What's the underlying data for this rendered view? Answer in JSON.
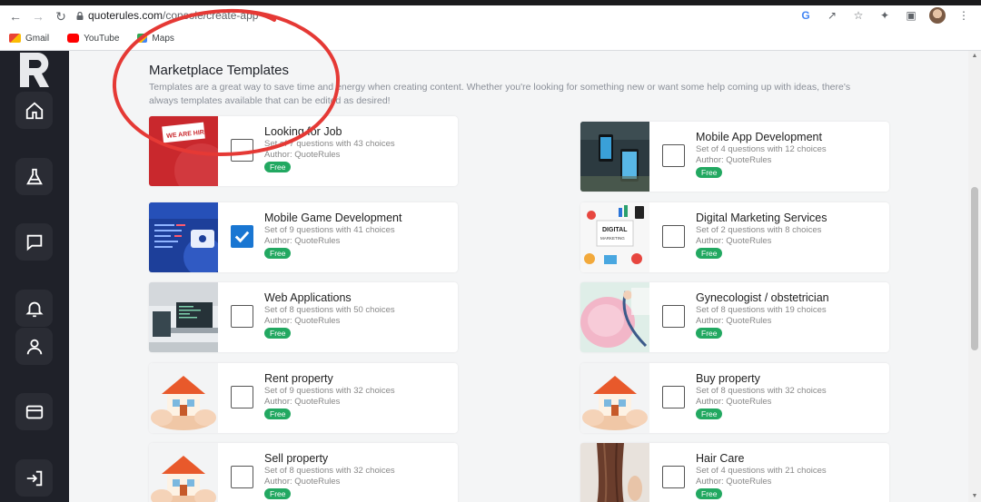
{
  "browser": {
    "url_domain": "quoterules.com",
    "url_path": "/console/create-app",
    "bookmarks": [
      {
        "label": "Gmail",
        "color": "#d93025"
      },
      {
        "label": "YouTube",
        "color": "#ff0000"
      },
      {
        "label": "Maps",
        "color": "#34a853"
      }
    ]
  },
  "sidebar": {
    "items": [
      {
        "icon": "home-icon"
      },
      {
        "icon": "flask-icon"
      },
      {
        "icon": "chat-icon"
      },
      {
        "icon": "bell-icon"
      },
      {
        "icon": "user-icon"
      },
      {
        "icon": "card-icon"
      },
      {
        "icon": "logout-icon"
      }
    ]
  },
  "page": {
    "heading": "Marketplace Templates",
    "description": "Templates are a great way to save time and energy when creating content. Whether you're looking for something new or want some help coming up with ideas, there's always templates available that can be edited as desired!"
  },
  "templates": [
    {
      "title": "Looking for Job",
      "questions": "Set of 7 questions with 43 choices",
      "author": "Author: QuoteRules",
      "badge": "Free",
      "checked": false,
      "thumb": "hiring"
    },
    {
      "title": "Mobile App Development",
      "questions": "Set of 4 questions with 12 choices",
      "author": "Author: QuoteRules",
      "badge": "Free",
      "checked": false,
      "thumb": "phone"
    },
    {
      "title": "Mobile Game Development",
      "questions": "Set of 9 questions with 41 choices",
      "author": "Author: QuoteRules",
      "badge": "Free",
      "checked": true,
      "thumb": "game"
    },
    {
      "title": "Digital Marketing Services",
      "questions": "Set of 2 questions with 8 choices",
      "author": "Author: QuoteRules",
      "badge": "Free",
      "checked": false,
      "thumb": "marketing"
    },
    {
      "title": "Web Applications",
      "questions": "Set of 8 questions with 50 choices",
      "author": "Author: QuoteRules",
      "badge": "Free",
      "checked": false,
      "thumb": "laptop"
    },
    {
      "title": "Gynecologist / obstetrician",
      "questions": "Set of 8 questions with 19 choices",
      "author": "Author: QuoteRules",
      "badge": "Free",
      "checked": false,
      "thumb": "pregnant"
    },
    {
      "title": "Rent property",
      "questions": "Set of 9 questions with 32 choices",
      "author": "Author: QuoteRules",
      "badge": "Free",
      "checked": false,
      "thumb": "house"
    },
    {
      "title": "Buy property",
      "questions": "Set of 8 questions with 32 choices",
      "author": "Author: QuoteRules",
      "badge": "Free",
      "checked": false,
      "thumb": "house"
    },
    {
      "title": "Sell property",
      "questions": "Set of 8 questions with 32 choices",
      "author": "Author: QuoteRules",
      "badge": "Free",
      "checked": false,
      "thumb": "house"
    },
    {
      "title": "Hair Care",
      "questions": "Set of 4 questions with 21 choices",
      "author": "Author: QuoteRules",
      "badge": "Free",
      "checked": false,
      "thumb": "hair"
    }
  ],
  "colors": {
    "badge": "#22a861",
    "checkbox_checked": "#1976d2",
    "annotation_circle": "#e53935",
    "sidebar_bg": "#1f2129"
  }
}
